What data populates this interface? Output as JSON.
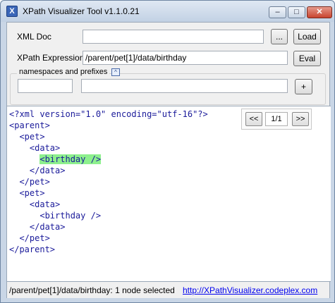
{
  "window": {
    "title": "XPath Visualizer Tool v1.1.0.21",
    "controls": {
      "minimize": "–",
      "maximize": "□",
      "close": "✕"
    }
  },
  "form": {
    "xml_doc_label": "XML Doc",
    "xml_doc_value": "",
    "browse_label": "...",
    "load_label": "Load",
    "xpath_label": "XPath Expression",
    "xpath_value": "/parent/pet[1]/data/birthday",
    "eval_label": "Eval",
    "namespaces_caption": "namespaces and prefixes",
    "collapse_symbol": "^",
    "prefix_value": "",
    "namespace_value": "",
    "add_label": "+"
  },
  "pager": {
    "prev_label": "<<",
    "count": "1/1",
    "next_label": ">>"
  },
  "xml_lines": [
    "<?xml version=\"1.0\" encoding=\"utf-16\"?>",
    "<parent>",
    "  <pet>",
    "    <data>",
    "      <birthday />",
    "    </data>",
    "  </pet>",
    "  <pet>",
    "    <data>",
    "      <birthday />",
    "    </data>",
    "  </pet>",
    "</parent>"
  ],
  "highlight_line": 4,
  "status": {
    "text": "/parent/pet[1]/data/birthday: 1 node selected",
    "link": "http://XPathVisualizer.codeplex.com"
  }
}
